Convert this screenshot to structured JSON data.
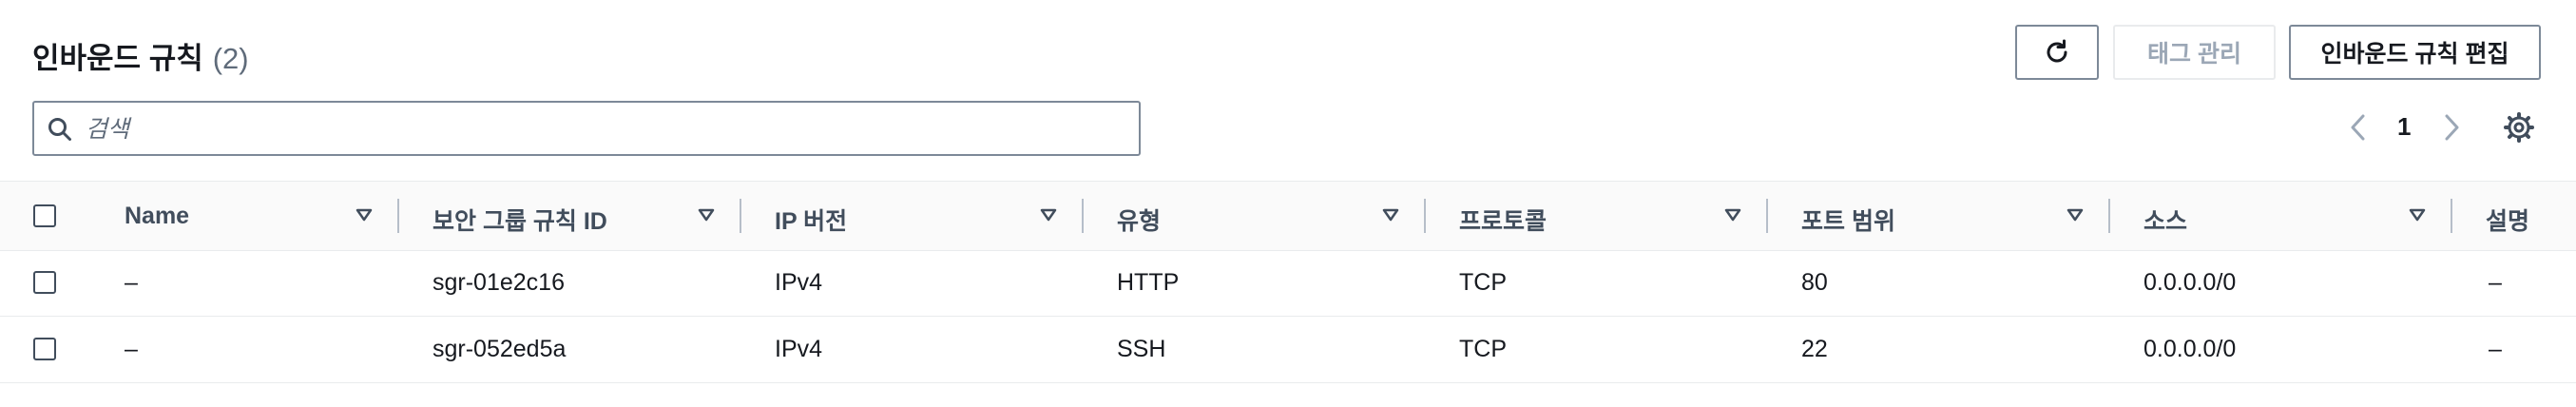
{
  "header": {
    "title": "인바운드 규칙",
    "count": "(2)",
    "manage_tags_label": "태그 관리",
    "edit_rules_label": "인바운드 규칙 편집"
  },
  "search": {
    "placeholder": "검색",
    "value": ""
  },
  "pagination": {
    "current_page": "1"
  },
  "icons": {
    "refresh": "refresh-icon",
    "search": "search-icon",
    "prev": "chevron-left-icon",
    "next": "chevron-right-icon",
    "settings": "gear-icon",
    "sort": "caret-down-icon"
  },
  "table": {
    "columns": [
      "Name",
      "보안 그룹 규칙 ID",
      "IP 버전",
      "유형",
      "프로토콜",
      "포트 범위",
      "소스",
      "설명"
    ],
    "rows": [
      {
        "name": "–",
        "rule_id": "sgr-01e2c16",
        "ip_version": "IPv4",
        "type": "HTTP",
        "protocol": "TCP",
        "port_range": "80",
        "source": "0.0.0.0/0",
        "description": "–"
      },
      {
        "name": "–",
        "rule_id": "sgr-052ed5a",
        "ip_version": "IPv4",
        "type": "SSH",
        "protocol": "TCP",
        "port_range": "22",
        "source": "0.0.0.0/0",
        "description": "–"
      }
    ]
  },
  "colors": {
    "text": "#16191f",
    "header_text": "#414d5c",
    "border": "#7d8998",
    "disabled": "#9ba7b6",
    "header_bg": "#fafafa"
  }
}
